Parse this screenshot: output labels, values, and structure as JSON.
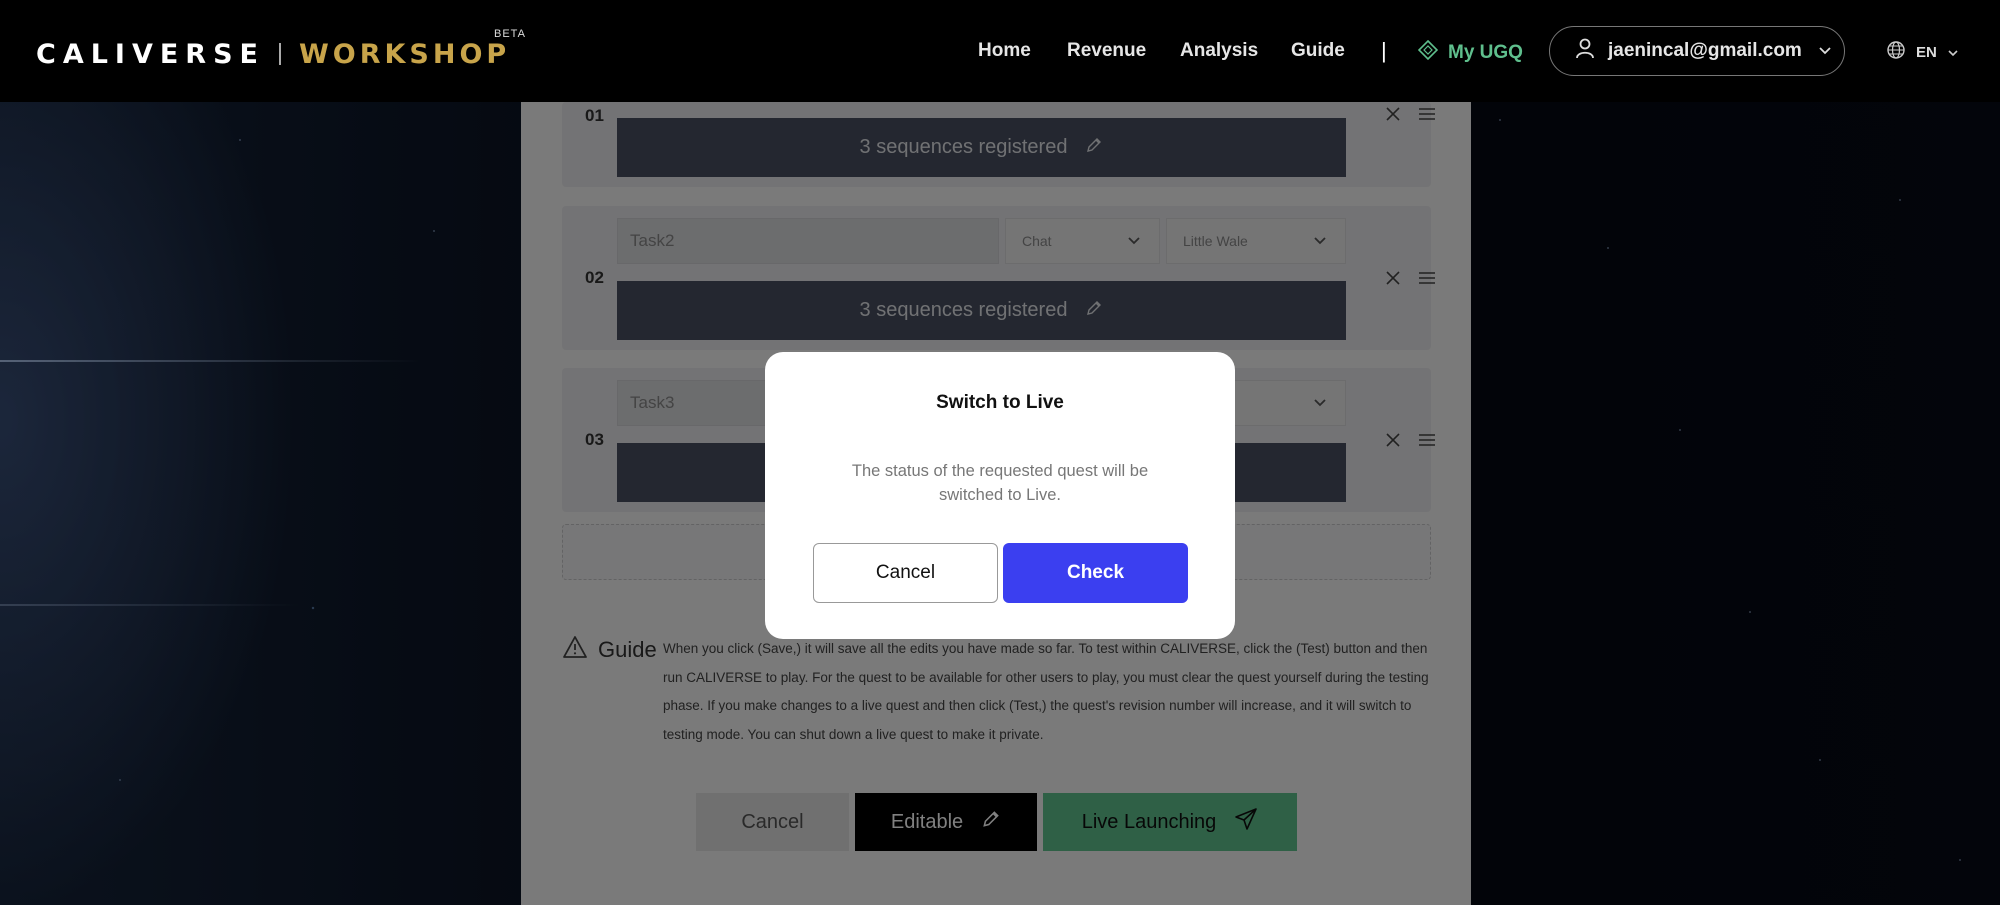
{
  "header": {
    "logo_main": "CALIVERSE",
    "logo_product": "WORKSHOP",
    "logo_badge": "BETA",
    "nav": [
      "Home",
      "Revenue",
      "Analysis",
      "Guide"
    ],
    "divider": "|",
    "my_ugq": "My UGQ",
    "user_email": "jaenincal@gmail.com",
    "language": "EN"
  },
  "tasks": [
    {
      "number": "01",
      "sequence_label": "3 sequences registered"
    },
    {
      "number": "02",
      "name": "Task2",
      "type": "Chat",
      "npc": "Little Wale",
      "sequence_label": "3 sequences registered"
    },
    {
      "number": "03",
      "name": "Task3"
    }
  ],
  "guide": {
    "title": "Guide",
    "text": "When you click (Save,) it will save all the edits you have made so far. To test within CALIVERSE, click the (Test) button and then run CALIVERSE to play. For the quest to be available for other users to play, you must clear the quest yourself during the testing phase. If you make changes to a live quest and then click (Test,) the quest's revision number will increase, and it will switch to testing mode. You can shut down a live quest to make it private."
  },
  "actions": {
    "cancel": "Cancel",
    "editable": "Editable",
    "live_launching": "Live Launching"
  },
  "dialog": {
    "title": "Switch to Live",
    "message": "The status of the requested quest will be switched to Live.",
    "cancel": "Cancel",
    "check": "Check"
  },
  "colors": {
    "brand_gold": "#c8a44a",
    "accent_green": "#5fbf8d",
    "primary_blue": "#3b3ff0",
    "sequence_bar": "#4a5060"
  }
}
